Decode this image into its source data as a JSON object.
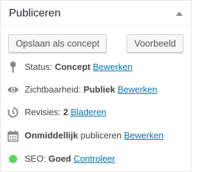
{
  "panel": {
    "title": "Publiceren"
  },
  "buttons": {
    "save_draft": "Opslaan als concept",
    "preview": "Voorbeeld"
  },
  "status": {
    "label": "Status:",
    "value": "Concept",
    "link": "Bewerken"
  },
  "visibility": {
    "label": "Zichtbaarheid:",
    "value": "Publiek",
    "link": "Bewerken"
  },
  "revisions": {
    "label": "Revisies:",
    "value": "2",
    "link": "Bladeren"
  },
  "schedule": {
    "value": "Onmiddellijk",
    "label": "publiceren",
    "link": "Bewerken"
  },
  "seo": {
    "label": "SEO:",
    "value": "Goed",
    "link": "Controleer",
    "color": "#5cd65c"
  },
  "colors": {
    "link": "#0073aa",
    "icon": "#82878c"
  }
}
